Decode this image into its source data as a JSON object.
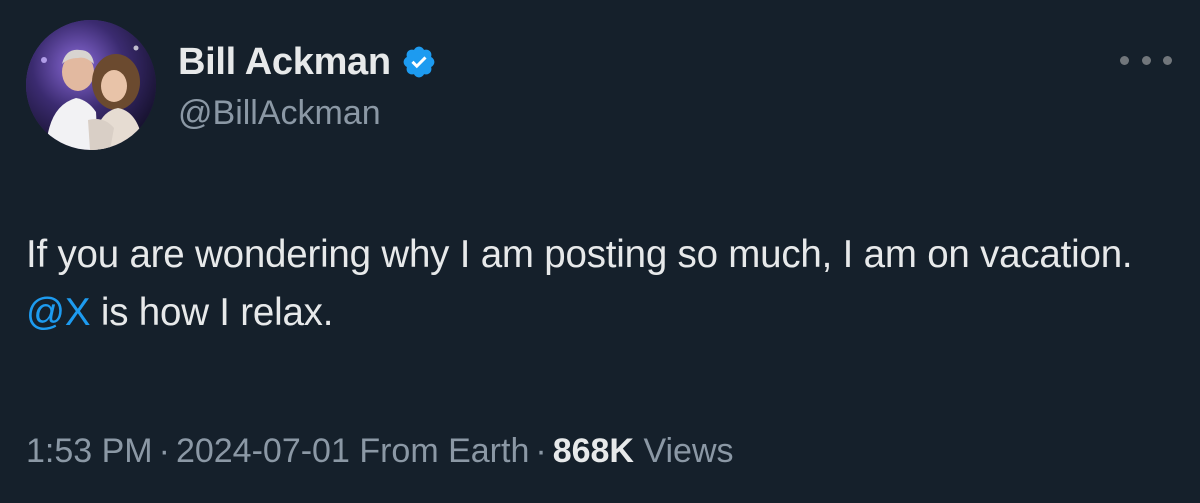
{
  "author": {
    "display_name": "Bill Ackman",
    "handle": "@BillAckman",
    "verified": true
  },
  "tweet": {
    "text_part1": "If you are wondering why I am posting so much, I am on vacation. ",
    "mention": "@X",
    "text_part2": " is how I relax."
  },
  "meta": {
    "time": "1:53 PM",
    "separator": "·",
    "date": "2024-07-01",
    "source": "From Earth",
    "views_count": "868K",
    "views_label": "Views"
  },
  "icons": {
    "verified": "verified-badge-icon",
    "more": "more-options-icon"
  },
  "colors": {
    "background": "#15202b",
    "text": "#e7e9ea",
    "muted": "#8b98a5",
    "accent": "#1d9bf0"
  }
}
